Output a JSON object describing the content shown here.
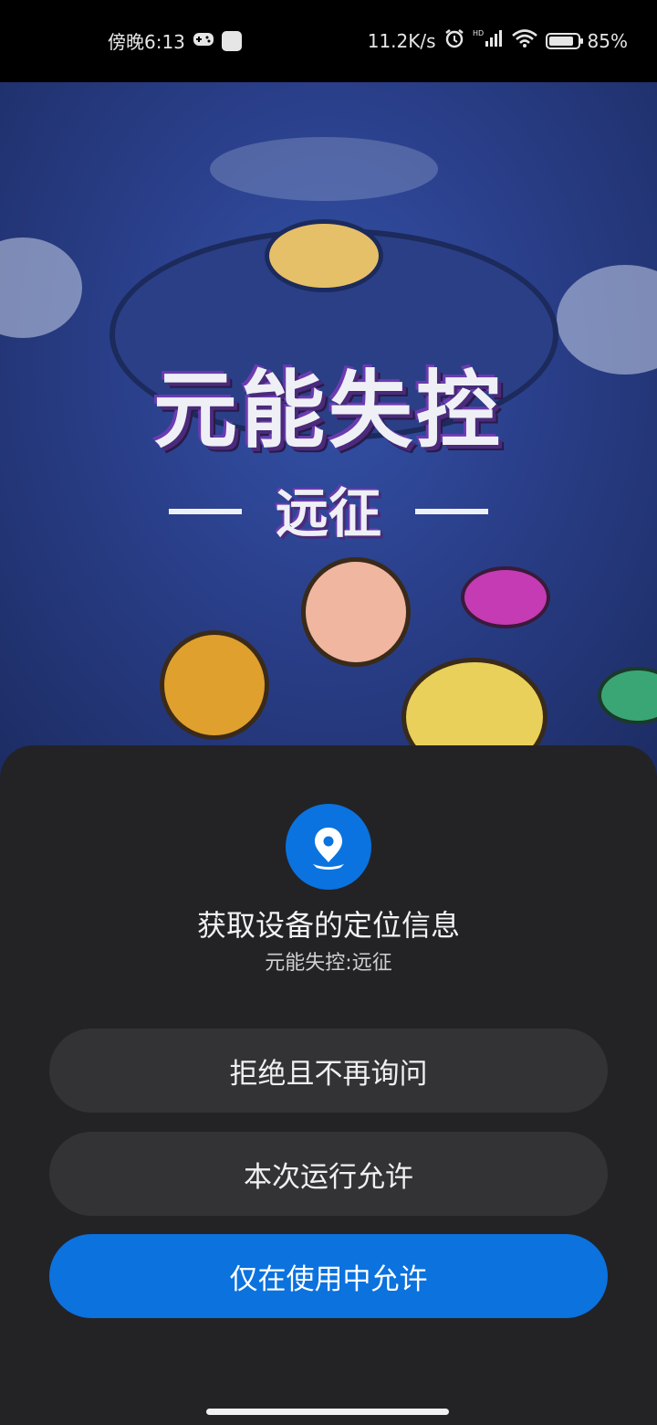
{
  "status_bar": {
    "time": "傍晚6:13",
    "network_speed": "11.2K/s",
    "battery_percent": "85%",
    "battery_level": 0.85
  },
  "game": {
    "title": "元能失控",
    "subtitle": "远征"
  },
  "dialog": {
    "icon": "location-pin-icon",
    "title": "获取设备的定位信息",
    "app_name": "元能失控:远征",
    "buttons": {
      "deny": "拒绝且不再询问",
      "allow_once": "本次运行允许",
      "allow_while_using": "仅在使用中允许"
    }
  },
  "colors": {
    "accent": "#0b72de",
    "sheet_bg": "#232326",
    "button_bg": "#333336"
  }
}
